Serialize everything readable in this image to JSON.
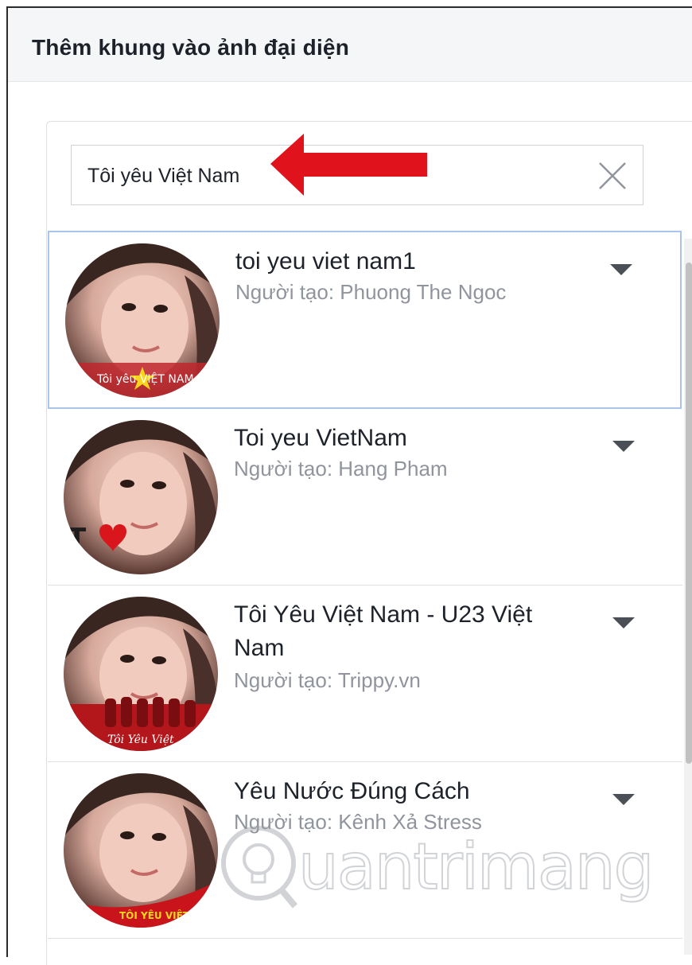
{
  "dialog": {
    "title": "Thêm khung vào ảnh đại diện"
  },
  "search": {
    "value": "Tôi yêu Việt Nam",
    "placeholder": ""
  },
  "results": [
    {
      "title": "toi yeu viet nam1",
      "creator": "Người tạo: Phuong The Ngoc",
      "frame_caption": "Tôi yêu VIỆT NAM"
    },
    {
      "title": "Toi yeu VietNam",
      "creator": "Người tạo: Hang Pham",
      "frame_caption": "T"
    },
    {
      "title": "Tôi Yêu Việt Nam - U23 Việt Nam",
      "creator": "Người tạo: Trippy.vn",
      "frame_caption": "Tôi Yêu Việt"
    },
    {
      "title": "Yêu Nước Đúng Cách",
      "creator": "Người tạo: Kênh Xả Stress",
      "frame_caption": "TÔI YÊU VIỆT NAM"
    }
  ],
  "watermark": {
    "text": "uantrimang"
  },
  "colors": {
    "arrow": "#e0121b",
    "selected_border": "#a8c3ee",
    "secondary_text": "#90949c"
  }
}
